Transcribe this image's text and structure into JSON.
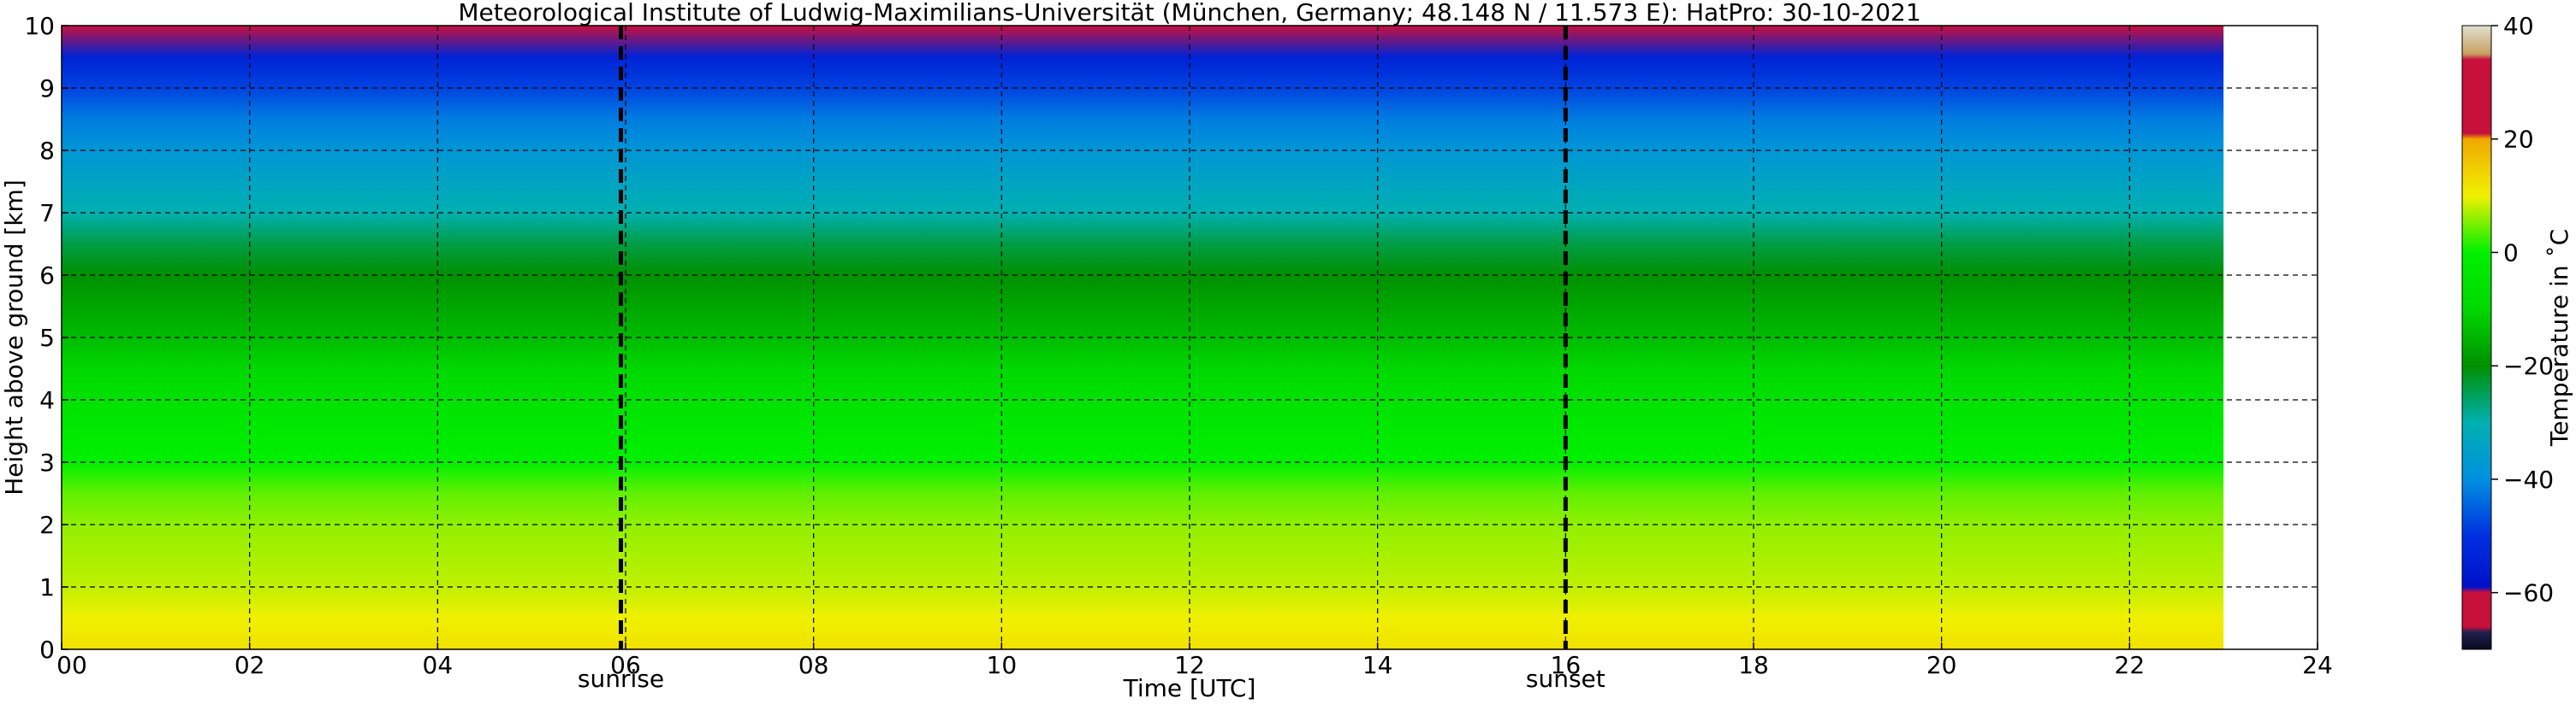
{
  "chart_data": {
    "type": "heatmap",
    "title": "Meteorological Institute of Ludwig-Maximilians-Universität (München, Germany; 48.148 N / 11.573 E):    HatPro: 30-10-2021",
    "xlabel": "Time [UTC]",
    "ylabel": "Height above ground [km]",
    "xlim": [
      0,
      24
    ],
    "ylim": [
      0,
      10
    ],
    "data_x_range": [
      0,
      23
    ],
    "x_ticks": [
      0,
      2,
      4,
      6,
      8,
      10,
      12,
      14,
      16,
      18,
      20,
      22,
      24
    ],
    "x_tick_labels": [
      "00",
      "02",
      "04",
      "06",
      "08",
      "10",
      "12",
      "14",
      "16",
      "18",
      "20",
      "22",
      "24"
    ],
    "y_ticks": [
      0,
      1,
      2,
      3,
      4,
      5,
      6,
      7,
      8,
      9,
      10
    ],
    "y_tick_labels": [
      "0",
      "1",
      "2",
      "3",
      "4",
      "5",
      "6",
      "7",
      "8",
      "9",
      "10"
    ],
    "grid": true,
    "events": [
      {
        "label": "sunrise",
        "time": 5.95
      },
      {
        "label": "sunset",
        "time": 16.0
      }
    ],
    "temperature_by_height": {
      "heights_km": [
        0,
        0.5,
        1,
        1.5,
        2,
        2.5,
        3,
        3.5,
        4,
        4.5,
        5,
        5.5,
        6,
        6.5,
        7,
        7.5,
        8,
        8.5,
        9,
        9.5,
        10
      ],
      "temp_c": [
        12,
        10,
        8,
        7,
        6,
        4,
        0,
        -3,
        -6,
        -10,
        -14,
        -17,
        -20,
        -24,
        -30,
        -34,
        -38,
        -42,
        -48,
        -54,
        -60
      ]
    },
    "colorbar": {
      "label": "Temperature in ˚C",
      "range": [
        -70,
        40
      ],
      "ticks": [
        40,
        20,
        0,
        -20,
        -40,
        -60
      ],
      "tick_labels": [
        "40",
        "20",
        "0",
        "−20",
        "−40",
        "−60"
      ],
      "stops": [
        {
          "t": -70,
          "color": "#0a0a1e"
        },
        {
          "t": -67,
          "color": "#202050"
        },
        {
          "t": -66,
          "color": "#c8103c"
        },
        {
          "t": -60,
          "color": "#c8103c"
        },
        {
          "t": -59,
          "color": "#0010c8"
        },
        {
          "t": -50,
          "color": "#0030e0"
        },
        {
          "t": -40,
          "color": "#0090e0"
        },
        {
          "t": -30,
          "color": "#00b0b0"
        },
        {
          "t": -20,
          "color": "#009000"
        },
        {
          "t": -10,
          "color": "#00d800"
        },
        {
          "t": 0,
          "color": "#00f000"
        },
        {
          "t": 10,
          "color": "#f0f000"
        },
        {
          "t": 20,
          "color": "#f0a800"
        },
        {
          "t": 21,
          "color": "#c8103c"
        },
        {
          "t": 34,
          "color": "#c8103c"
        },
        {
          "t": 35,
          "color": "#c8a060"
        },
        {
          "t": 40,
          "color": "#e0e0d0"
        }
      ]
    }
  }
}
